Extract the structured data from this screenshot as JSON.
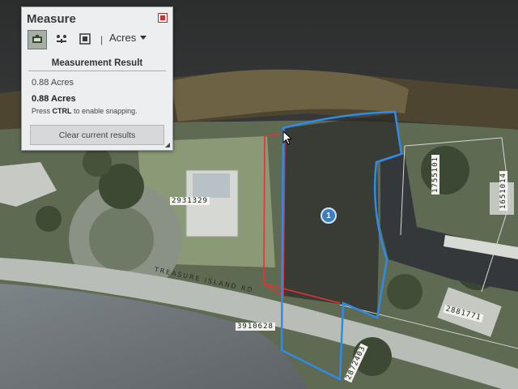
{
  "panel": {
    "title": "Measure",
    "unit": "Acres",
    "section_header": "Measurement Result",
    "result_value": "0.88 Acres",
    "result_value_bold": "0.88 Acres",
    "hint_prefix": "Press",
    "hint_key": "CTRL",
    "hint_suffix": "to enable snapping.",
    "clear_button": "Clear current results",
    "tools": [
      "area-tool-icon",
      "distance-tool-icon",
      "location-tool-icon"
    ]
  },
  "map": {
    "parcel_labels": [
      "2931329",
      "3910628",
      "1755101",
      "1651014",
      "2881771",
      "2872403"
    ],
    "road_label": "TREASURE ISLAND RD",
    "marker_label": "1",
    "colors": {
      "measure_outline": "#2f8be8",
      "parcel_outline": "#e23434"
    }
  }
}
